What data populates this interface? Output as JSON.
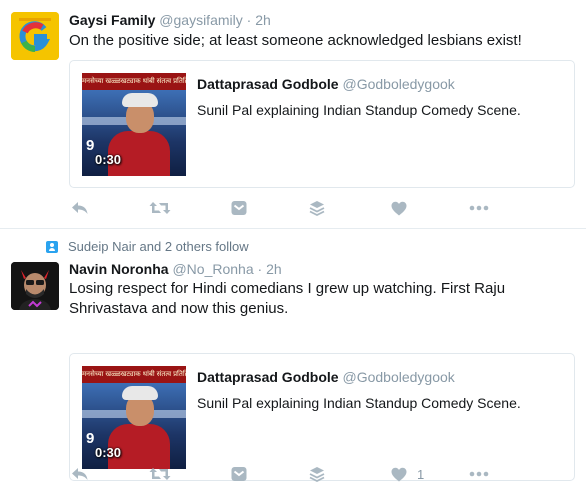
{
  "tweets": [
    {
      "context": "",
      "name": "Gaysi Family",
      "handle": "@gaysifamily",
      "dot": "·",
      "time": "2h",
      "text": "On the positive side; at least someone acknowledged lesbians exist!",
      "card": {
        "name": "Dattaprasad Godbole",
        "handle": "@Godboledygook",
        "description": "Sunil Pal explaining Indian Standup Comedy Scene.",
        "duration": "0:30",
        "banner": "मनसेच्या खळ्ळखट्याक थांबी संतत्व प्रतिक्रिया"
      },
      "actions": {
        "like_count": ""
      }
    },
    {
      "context": "Sudeip Nair and 2 others follow",
      "name": "Navin Noronha",
      "handle": "@No_Ronha",
      "dot": "·",
      "time": "2h",
      "text": "Losing respect for Hindi comedians I grew up watching. First Raju Shrivastava and now this genius.",
      "card": {
        "name": "Dattaprasad Godbole",
        "handle": "@Godboledygook",
        "description": "Sunil Pal explaining Indian Standup Comedy Scene.",
        "duration": "0:30",
        "banner": "मनसेच्या खळ्ळखट्याक थांबी संतत्व प्रतिक्रिया"
      },
      "actions": {
        "like_count": "1"
      }
    }
  ],
  "icons": {
    "reply": "reply-icon",
    "retweet": "retweet-icon",
    "dm": "direct-message-icon",
    "stack": "stack-icon",
    "like": "heart-icon",
    "more": "more-icon",
    "context": "person-icon"
  },
  "colors": {
    "action_gray": "#aab8c2",
    "meta_gray": "#8899a6",
    "context_blue": "#2aa3ef",
    "gaysi_yellow": "#f5c400"
  }
}
